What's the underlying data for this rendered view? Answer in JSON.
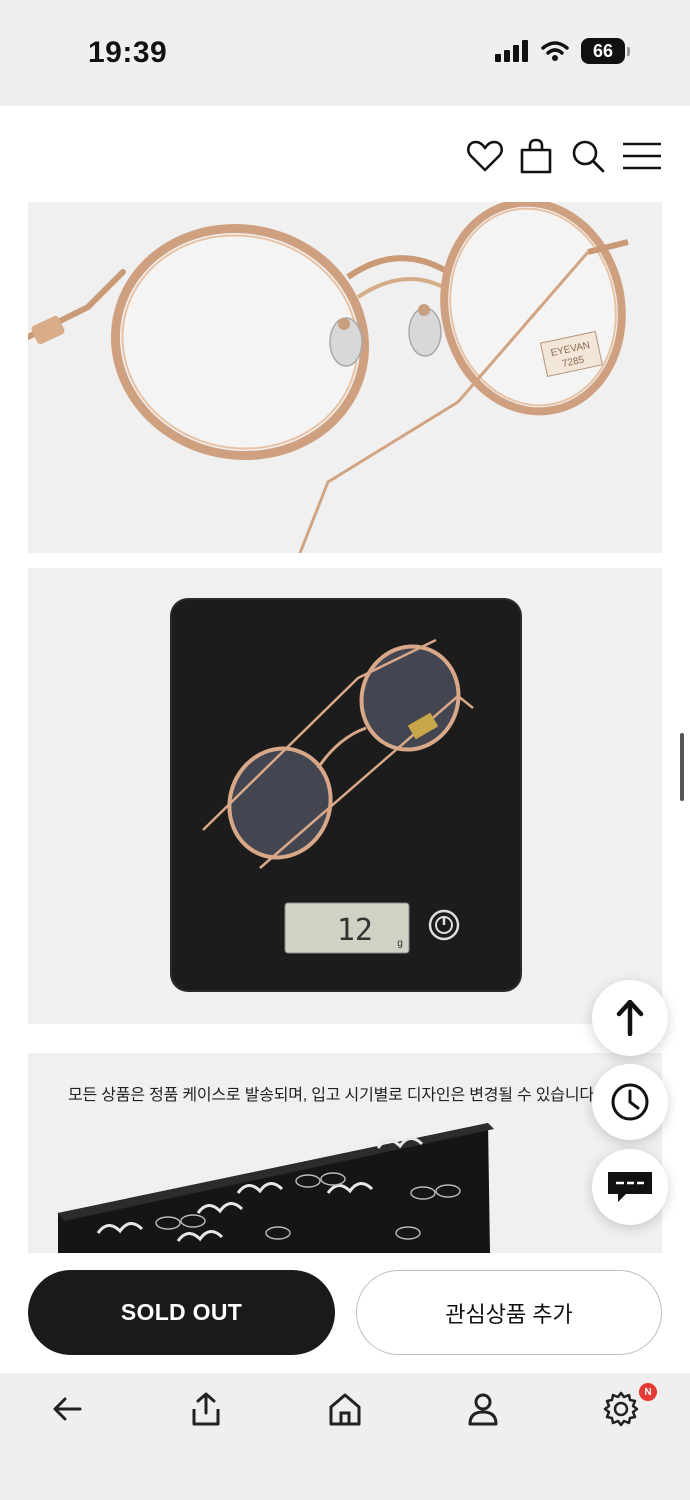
{
  "status_bar": {
    "time": "19:39",
    "battery": "66"
  },
  "header_icons": [
    "heart-icon",
    "bag-icon",
    "search-icon",
    "menu-icon"
  ],
  "product_images": [
    {
      "name": "gold-round-glasses-closeup",
      "engraving_line1": "EYEVAN",
      "engraving_line2": "7285"
    },
    {
      "name": "glasses-on-kitchen-scale",
      "scale_reading": "12",
      "scale_unit": "g"
    },
    {
      "name": "case-packaging",
      "notice": "모든 상품은 정품 케이스로 발송되며, 입고 시기별로 디자인은 변경될 수 있습니다."
    }
  ],
  "floating_buttons": [
    "scroll-top-icon",
    "recent-history-icon",
    "chat-icon"
  ],
  "actions": {
    "sold_out": "SOLD OUT",
    "wishlist": "관심상품 추가"
  },
  "bottom_nav": {
    "items": [
      "back-icon",
      "share-icon",
      "home-icon",
      "account-icon",
      "settings-icon"
    ],
    "settings_badge": "N"
  },
  "colors": {
    "primary_button": "#1a1a1a",
    "badge": "#e53935",
    "panel_bg": "#f0f0f0"
  }
}
